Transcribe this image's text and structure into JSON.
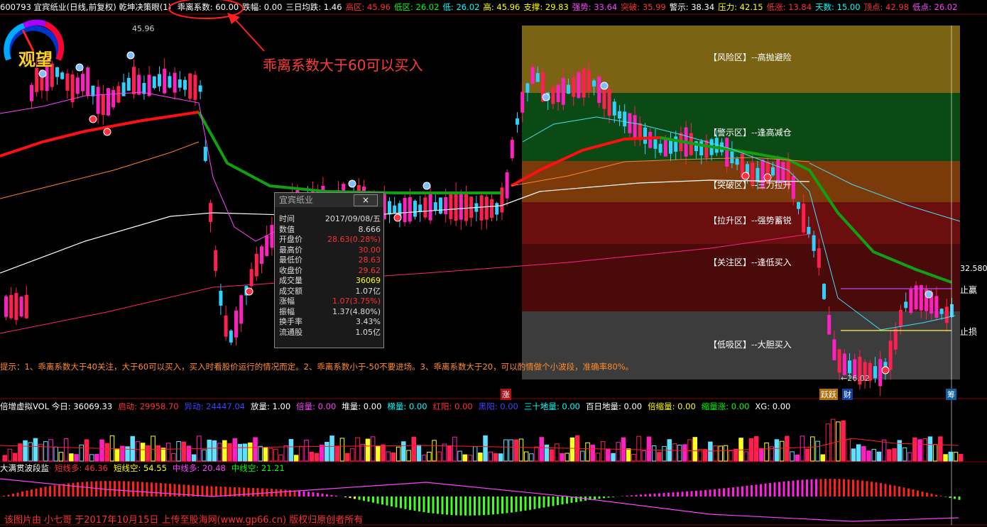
{
  "header": {
    "code_name": "600793 宜宾纸业(日线,前复权)",
    "indicator_name": "乾坤决策眼(1)",
    "items": [
      {
        "label": "乖离系数:",
        "value": "60.00",
        "color": "#ffffff"
      },
      {
        "label": "跌幅:",
        "value": "0.00",
        "color": "#ffffff"
      },
      {
        "label": "三日均跌:",
        "value": "1.46",
        "color": "#ffffff"
      },
      {
        "label": "高区:",
        "value": "45.96",
        "color": "#ff3030"
      },
      {
        "label": "低区:",
        "value": "26.02",
        "color": "#00ff00"
      },
      {
        "label": "低:",
        "value": "26.02",
        "color": "#00ffff"
      },
      {
        "label": "高:",
        "value": "45.96",
        "color": "#ffff00"
      },
      {
        "label": "支撑:",
        "value": "29.83",
        "color": "#ffff00"
      },
      {
        "label": "强势:",
        "value": "33.64",
        "color": "#ff40ff"
      },
      {
        "label": "突破:",
        "value": "35.99",
        "color": "#ff3030"
      },
      {
        "label": "警示:",
        "value": "38.34",
        "color": "#ffffff"
      },
      {
        "label": "压力:",
        "value": "42.15",
        "color": "#ffff00"
      },
      {
        "label": "低涨:",
        "value": "13.84",
        "color": "#ff3030"
      },
      {
        "label": "天数:",
        "value": "15.00",
        "color": "#00ffff"
      },
      {
        "label": "顶点:",
        "value": "42.98",
        "color": "#ff3030"
      },
      {
        "label": "低点:",
        "value": "26.02",
        "color": "#ff40ff"
      }
    ]
  },
  "gauge_label": "观望",
  "price_high_label": "45.96",
  "price_low_label": "26.02",
  "price_right_label": "32.580",
  "annotation": "乖离系数大于60可以买入",
  "zones": [
    {
      "label": "【风险区】--高抛避险",
      "color": "#7a6414"
    },
    {
      "label": "【警示区】--逢高减仓",
      "color": "#0b4a14"
    },
    {
      "label": "【突破区】--三力拉升",
      "color": "#7a3a0a"
    },
    {
      "label": "【拉升区】--强势蓄锐",
      "color": "#6a0e0e"
    },
    {
      "label": "【关注区】--逢低买入",
      "color": "#4a0a0a"
    },
    {
      "label": "【低吸区】--大胆买入",
      "color": "#3c3c3c"
    }
  ],
  "stop_labels": {
    "take_profit": "止赢",
    "stop_loss": "止损"
  },
  "bottom_tags": {
    "zhang": "涨",
    "yueyu": "跃跃",
    "cai": "财",
    "chou": "筹"
  },
  "popup": {
    "title": "宜宾纸业",
    "close": "×",
    "rows": [
      {
        "k": "时间",
        "v": "2017/09/08/五",
        "color": "#dddddd"
      },
      {
        "k": "数值",
        "v": "8.666",
        "color": "#dddddd"
      },
      {
        "k": "开盘价",
        "v": "28.63(0.28%)",
        "color": "#ff3030"
      },
      {
        "k": "最高价",
        "v": "30.00",
        "color": "#ff3030"
      },
      {
        "k": "最低价",
        "v": "28.63",
        "color": "#ff3030"
      },
      {
        "k": "收盘价",
        "v": "29.62",
        "color": "#ff3030"
      },
      {
        "k": "成交量",
        "v": "36069",
        "color": "#ffff00"
      },
      {
        "k": "成交额",
        "v": "1.07亿",
        "color": "#dddddd"
      },
      {
        "k": "涨幅",
        "v": "1.07(3.75%)",
        "color": "#ff3030"
      },
      {
        "k": "振幅",
        "v": "1.37(4.80%)",
        "color": "#dddddd"
      },
      {
        "k": "换手率",
        "v": "3.43%",
        "color": "#dddddd"
      },
      {
        "k": "流通股",
        "v": "1.05亿",
        "color": "#dddddd"
      }
    ]
  },
  "tip": "提示：1、乖离系数大于40关注，大于60可以买入，买入时看股价运行的情况而定。2、乖离系数小于-50不要进场。3、乖离系数大于20，可以酌情做个小波段，准确率80%。",
  "volume_header": [
    {
      "label": "倍增虚拟VOL 今日:",
      "value": "36069.33",
      "color": "#ffffff"
    },
    {
      "label": "启动:",
      "value": "29958.70",
      "color": "#ff3030"
    },
    {
      "label": "异动:",
      "value": "24447.04",
      "color": "#4040ff"
    },
    {
      "label": "放量:",
      "value": "1.00",
      "color": "#ffffff"
    },
    {
      "label": "倍量:",
      "value": "0.00",
      "color": "#ff40ff"
    },
    {
      "label": "堆量:",
      "value": "0.00",
      "color": "#ffffff"
    },
    {
      "label": "梯量:",
      "value": "0.00",
      "color": "#00ffff"
    },
    {
      "label": "红阳:",
      "value": "0.00",
      "color": "#ff3030"
    },
    {
      "label": "黑阳:",
      "value": "0.00",
      "color": "#4040ff"
    },
    {
      "label": "三十地量:",
      "value": "0.00",
      "color": "#00ffff"
    },
    {
      "label": "百日地量:",
      "value": "0.00",
      "color": "#ffffff"
    },
    {
      "label": "倍缩量:",
      "value": "0.00",
      "color": "#ffff00"
    },
    {
      "label": "缩量涨:",
      "value": "0.00",
      "color": "#00ff00"
    },
    {
      "label": "XG:",
      "value": "0.00",
      "color": "#ffffff"
    }
  ],
  "osc_header": [
    {
      "label": "大满贯波段监",
      "value": "",
      "color": "#ffffff"
    },
    {
      "label": "短线多:",
      "value": "46.36",
      "color": "#ff3030"
    },
    {
      "label": "短线空:",
      "value": "54.55",
      "color": "#ffff00"
    },
    {
      "label": "中线多:",
      "value": "20.48",
      "color": "#ff40ff"
    },
    {
      "label": "中线空:",
      "value": "21.21",
      "color": "#00ff00"
    }
  ],
  "footer": "该图片由 小七哥 于2017年10月15日 上传至股海网(www.gp66.cn) 版权归原创者所有"
}
